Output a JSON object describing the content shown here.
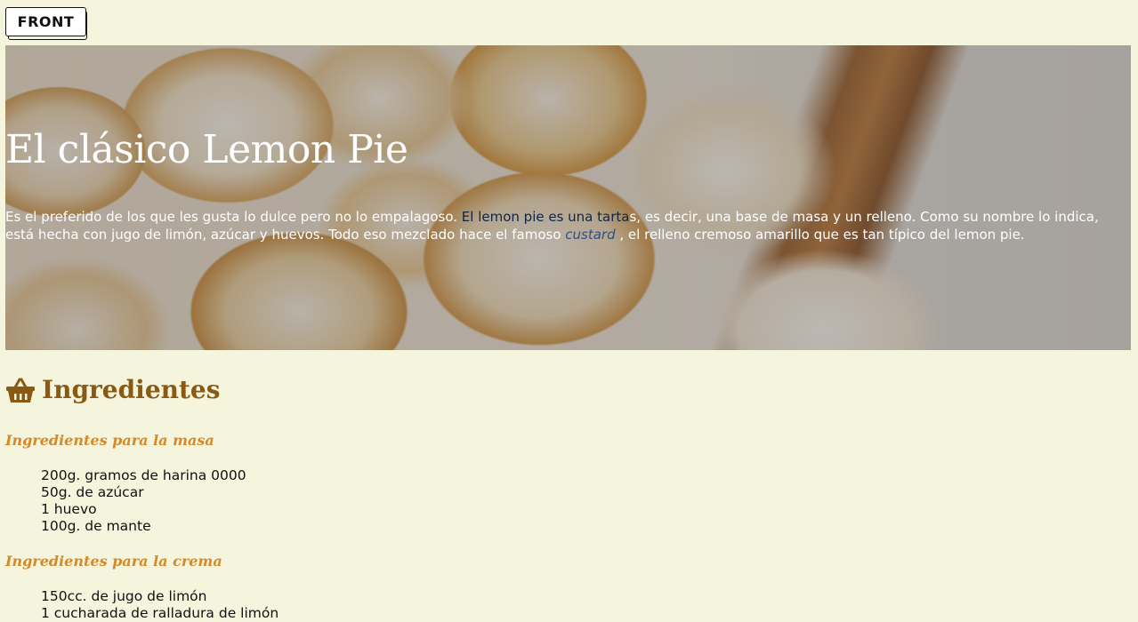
{
  "logo": {
    "text": "FRONT"
  },
  "hero": {
    "title": "El clásico Lemon Pie",
    "text_1": "Es el preferido de los que les gusta lo dulce pero no lo empalagoso. ",
    "link_1": "El lemon pie es una tarta",
    "text_2": "s, es decir, una base de masa y un relleno. Como su nombre lo indica, está hecha con jugo de limón, azúcar y huevos. Todo eso mezclado hace el famoso ",
    "link_2": "custard",
    "text_3": " , el relleno cremoso amarillo que es tan típico del lemon pie."
  },
  "ingredients": {
    "icon": "basket-icon",
    "title": "Ingredientes",
    "masa": {
      "title": "Ingredientes para la masa",
      "items": [
        "200g. gramos de harina 0000",
        "50g. de azúcar",
        "1 huevo",
        "100g. de mante"
      ]
    },
    "crema": {
      "title": "Ingredientes para la crema",
      "items": [
        "150cc. de jugo de limón",
        "1 cucharada de ralladura de limón"
      ]
    }
  },
  "colors": {
    "background": "#f5f4dc",
    "section_title": "#8a5a14",
    "subsection_title": "#d48a2a"
  }
}
